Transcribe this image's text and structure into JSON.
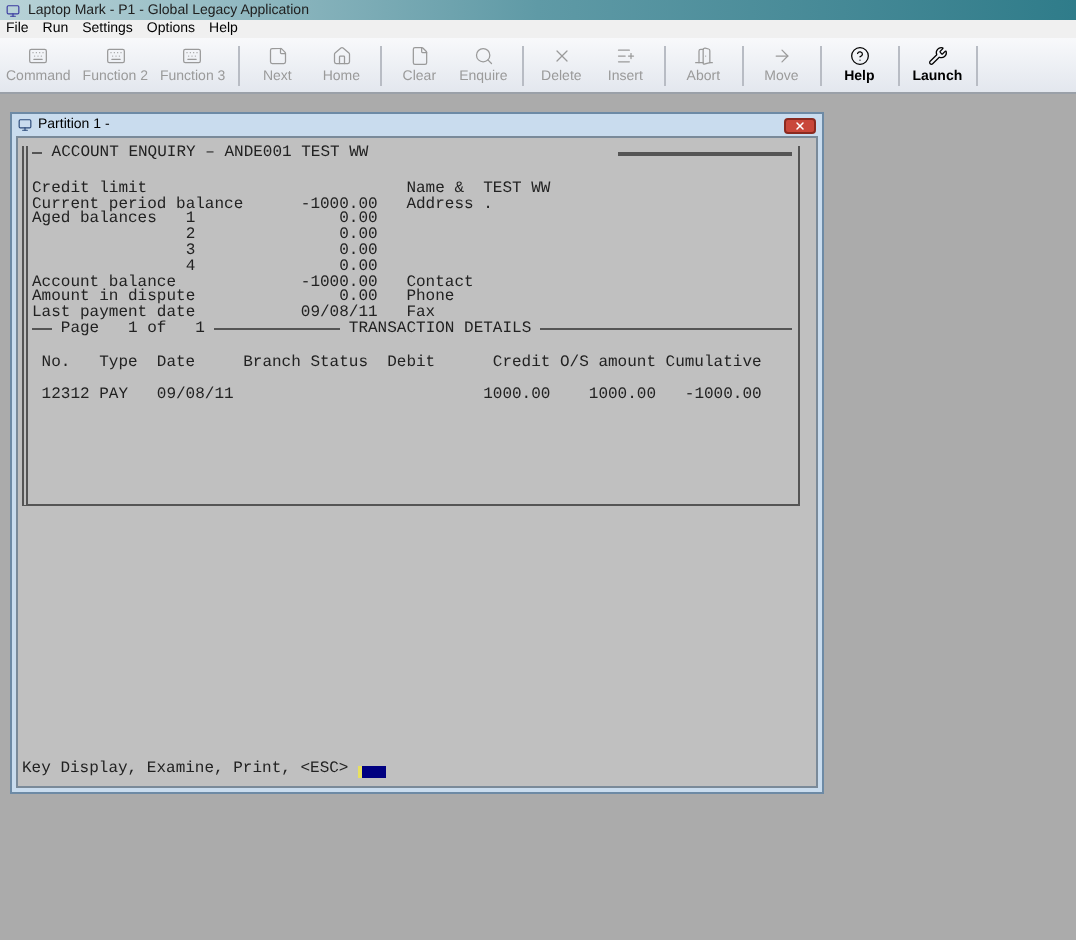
{
  "window": {
    "title": "Laptop Mark - P1 - Global Legacy Application"
  },
  "menu": [
    {
      "label": "File"
    },
    {
      "label": "Run"
    },
    {
      "label": "Settings"
    },
    {
      "label": "Options"
    },
    {
      "label": "Help"
    }
  ],
  "toolbar": [
    {
      "label": "Command",
      "disabled": true
    },
    {
      "label": "Function 2",
      "disabled": true
    },
    {
      "label": "Function 3",
      "disabled": true
    },
    {
      "label": "Next",
      "disabled": true
    },
    {
      "label": "Home",
      "disabled": true
    },
    {
      "label": "Clear",
      "disabled": true
    },
    {
      "label": "Enquire",
      "disabled": true
    },
    {
      "label": "Delete",
      "disabled": true
    },
    {
      "label": "Insert",
      "disabled": true
    },
    {
      "label": "Abort",
      "disabled": true
    },
    {
      "label": "Move",
      "disabled": true
    },
    {
      "label": "Help",
      "disabled": false
    },
    {
      "label": "Launch",
      "disabled": false
    }
  ],
  "partition": {
    "title": "Partition 1 -",
    "terminal": {
      "header": "ACCOUNT ENQUIRY – ANDE001 TEST WW",
      "summary": [
        {
          "label": "Credit limit",
          "side_label": "Name &",
          "side_value": "TEST WW"
        },
        {
          "label": "Current period balance",
          "value": "-1000.00",
          "side_label": "Address",
          "side_value": "."
        },
        {
          "label": "Aged balances",
          "bucket": "1",
          "value": "0.00"
        },
        {
          "bucket": "2",
          "value": "0.00"
        },
        {
          "bucket": "3",
          "value": "0.00"
        },
        {
          "bucket": "4",
          "value": "0.00"
        },
        {
          "label": "Account balance",
          "value": "-1000.00",
          "side_label": "Contact"
        },
        {
          "label": "Amount in dispute",
          "value": "0.00",
          "side_label": "Phone"
        },
        {
          "label": "Last payment date",
          "value": "09/08/11",
          "side_label": "Fax"
        }
      ],
      "page": {
        "label": "Page",
        "current": "1",
        "of": "of",
        "total": "1"
      },
      "section_title": "TRANSACTION DETAILS",
      "table": {
        "columns": [
          "No.",
          "Type",
          "Date",
          "Branch",
          "Status",
          "Debit",
          "Credit",
          "O/S amount",
          "Cumulative"
        ],
        "rows": [
          [
            "12312",
            "PAY",
            "09/08/11",
            "",
            "",
            "",
            "1000.00",
            "1000.00",
            "-1000.00"
          ]
        ]
      },
      "prompt": "Key Display, Examine, Print, <ESC>"
    }
  }
}
